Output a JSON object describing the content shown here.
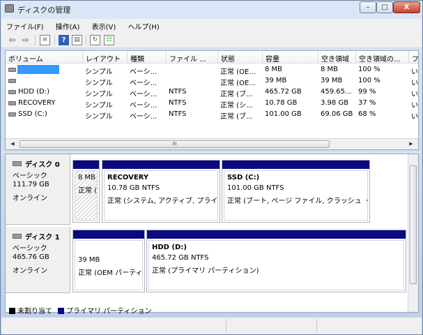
{
  "window": {
    "title": "ディスクの管理"
  },
  "title_buttons": {
    "minimize": "–",
    "maximize": "□",
    "close": "X"
  },
  "menu": [
    "ファイル(F)",
    "操作(A)",
    "表示(V)",
    "ヘルプ(H)"
  ],
  "toolbar": [
    "back-arrow-icon",
    "forward-arrow-icon",
    "properties-icon",
    "help-icon",
    "console-icon",
    "refresh-icon",
    "rescan-icon"
  ],
  "columns": [
    "ボリューム",
    "レイアウト",
    "種類",
    "ファイル ...",
    "状態",
    "容量",
    "空き領域",
    "空き領域の...",
    "フ"
  ],
  "volumes": [
    {
      "name": "",
      "layout": "シンプル",
      "type": "ベーシ...",
      "fs": "",
      "status": "正常 (OE...",
      "capacity": "8 MB",
      "free": "8 MB",
      "free_pct": "100 %",
      "extra": "い"
    },
    {
      "name": "",
      "layout": "シンプル",
      "type": "ベーシ...",
      "fs": "",
      "status": "正常 (OE...",
      "capacity": "39 MB",
      "free": "39 MB",
      "free_pct": "100 %",
      "extra": "い"
    },
    {
      "name": "HDD (D:)",
      "layout": "シンプル",
      "type": "ベーシ...",
      "fs": "NTFS",
      "status": "正常 (ブ...",
      "capacity": "465.72 GB",
      "free": "459.65...",
      "free_pct": "99 %",
      "extra": "い"
    },
    {
      "name": "RECOVERY",
      "layout": "シンプル",
      "type": "ベーシ...",
      "fs": "NTFS",
      "status": "正常 (シ...",
      "capacity": "10.78 GB",
      "free": "3.98 GB",
      "free_pct": "37 %",
      "extra": "い"
    },
    {
      "name": "SSD (C:)",
      "layout": "シンプル",
      "type": "ベーシ...",
      "fs": "NTFS",
      "status": "正常 (ブ...",
      "capacity": "101.00 GB",
      "free": "69.06 GB",
      "free_pct": "68 %",
      "extra": "い"
    }
  ],
  "scroll_grip": "III",
  "disks": [
    {
      "name": "ディスク 0",
      "type": "ベーシック",
      "size": "111.79 GB",
      "status": "オンライン",
      "partitions": [
        {
          "name": "",
          "size": "8 MB",
          "status": "正常 ("
        },
        {
          "name": "RECOVERY",
          "size": "10.78 GB NTFS",
          "status": "正常 (システム, アクティブ, プライ"
        },
        {
          "name": "SSD  (C:)",
          "size": "101.00 GB NTFS",
          "status": "正常 (ブート, ページ ファイル, クラッシュ ・"
        }
      ]
    },
    {
      "name": "ディスク 1",
      "type": "ベーシック",
      "size": "465.76 GB",
      "status": "オンライン",
      "partitions": [
        {
          "name": "",
          "size": "39 MB",
          "status": "正常 (OEM パーティ"
        },
        {
          "name": "HDD  (D:)",
          "size": "465.72 GB NTFS",
          "status": "正常 (プライマリ パーティション)"
        }
      ]
    }
  ],
  "legend": [
    {
      "label": "未割り当て",
      "color": "#000000"
    },
    {
      "label": "プライマリ パーティション",
      "color": "#0a0a80"
    }
  ],
  "colors": {
    "partition_bar": "#0a0a80",
    "selection": "#3399ff"
  }
}
